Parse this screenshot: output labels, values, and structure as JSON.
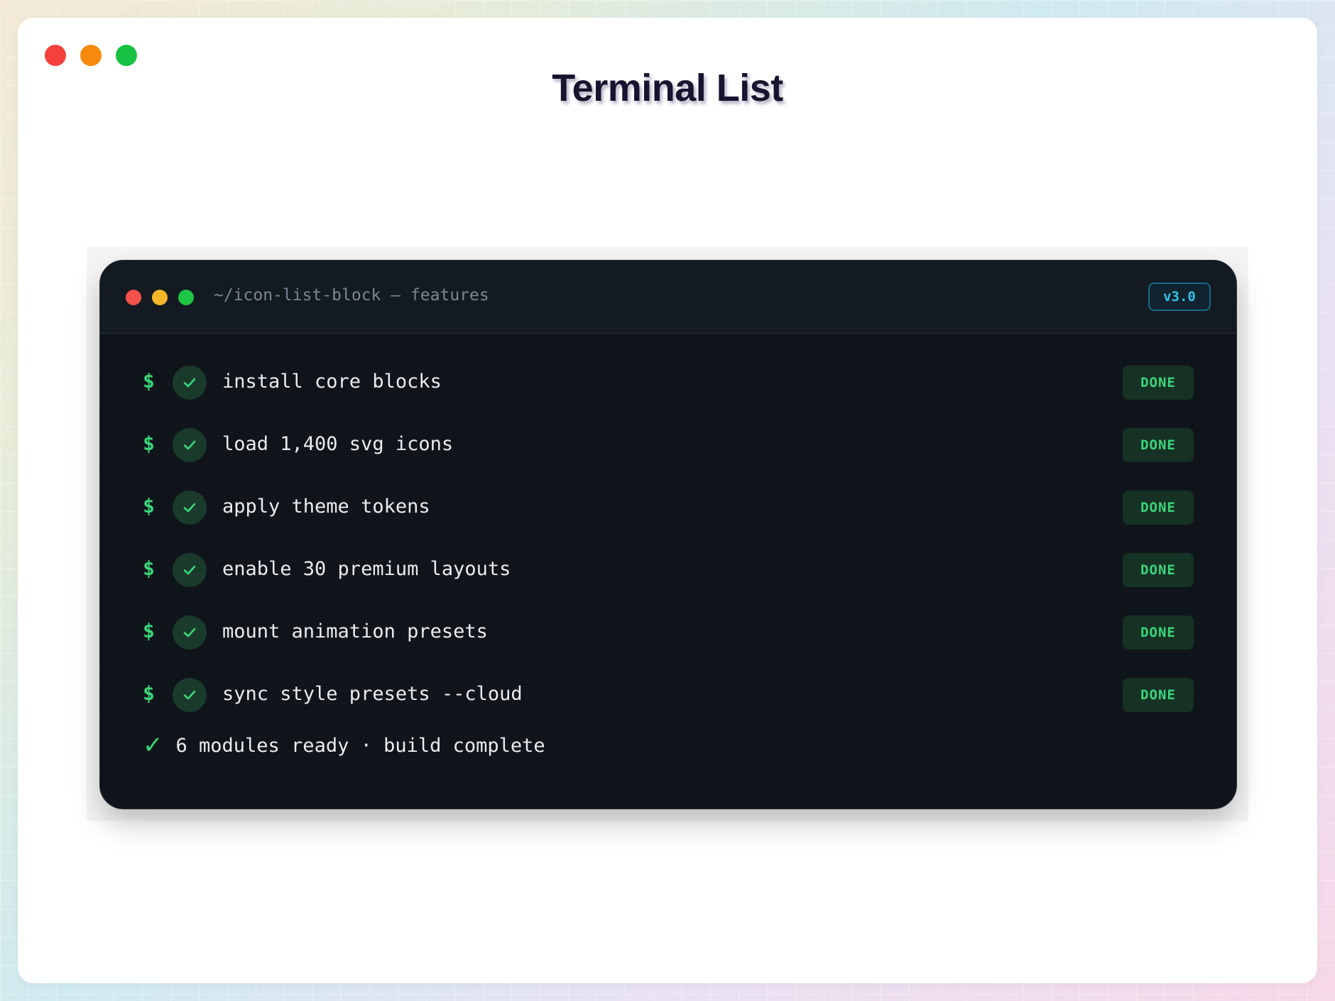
{
  "window": {
    "title": "Terminal List",
    "controls": [
      "close",
      "minimize",
      "maximize"
    ]
  },
  "terminal": {
    "path": "~/icon-list-block — features",
    "version": "v3.0",
    "prompt_symbol": "$",
    "tasks": [
      {
        "label": "install core blocks",
        "status": "DONE"
      },
      {
        "label": "load 1,400 svg icons",
        "status": "DONE"
      },
      {
        "label": "apply theme tokens",
        "status": "DONE"
      },
      {
        "label": "enable 30 premium layouts",
        "status": "DONE"
      },
      {
        "label": "mount animation presets",
        "status": "DONE"
      },
      {
        "label": "sync style presets --cloud",
        "status": "DONE"
      }
    ],
    "summary_icon": "✓",
    "summary": "6 modules ready · build complete"
  },
  "colors": {
    "accent_green": "#3bd57a",
    "terminal_bg": "#0e1319",
    "version_accent": "#2fc3ea"
  },
  "icons": {
    "task_icon": "check-icon",
    "summary_icon": "checkmark-icon"
  }
}
